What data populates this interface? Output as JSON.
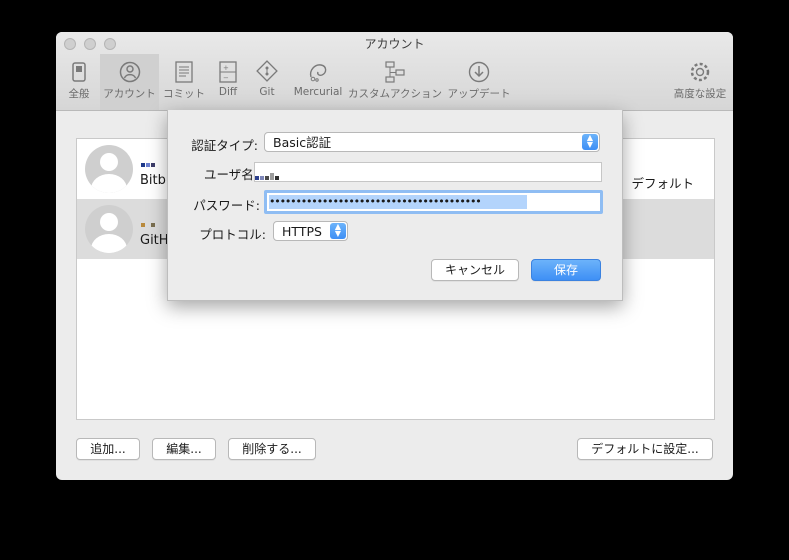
{
  "window": {
    "title": "アカウント"
  },
  "toolbar": {
    "items": [
      {
        "label": "全般"
      },
      {
        "label": "アカウント"
      },
      {
        "label": "コミット"
      },
      {
        "label": "Diff"
      },
      {
        "label": "Git"
      },
      {
        "label": "Mercurial"
      },
      {
        "label": "カスタムアクション"
      },
      {
        "label": "アップデート"
      },
      {
        "label": "高度な設定"
      }
    ],
    "selected": "アカウント"
  },
  "accounts": [
    {
      "service": "Bitbucket",
      "service_visible": "Bitbu",
      "default_label": "デフォルト"
    },
    {
      "service": "GitHub",
      "service_visible": "GitH"
    }
  ],
  "footer": {
    "add": "追加...",
    "edit": "編集...",
    "delete": "削除する...",
    "set_default": "デフォルトに設定..."
  },
  "dialog": {
    "auth_type_label": "認証タイプ:",
    "auth_type_value": "Basic認証",
    "username_label": "ユーザ名:",
    "password_label": "パスワード:",
    "password_mask": "••••••••••••••••••••••••••••••••••••••••",
    "protocol_label": "プロトコル:",
    "protocol_value": "HTTPS",
    "cancel": "キャンセル",
    "save": "保存"
  },
  "colors": {
    "accent": "#3e8ff5",
    "focus_ring": "#8fbdf3",
    "selection": "#b3d4fc"
  }
}
